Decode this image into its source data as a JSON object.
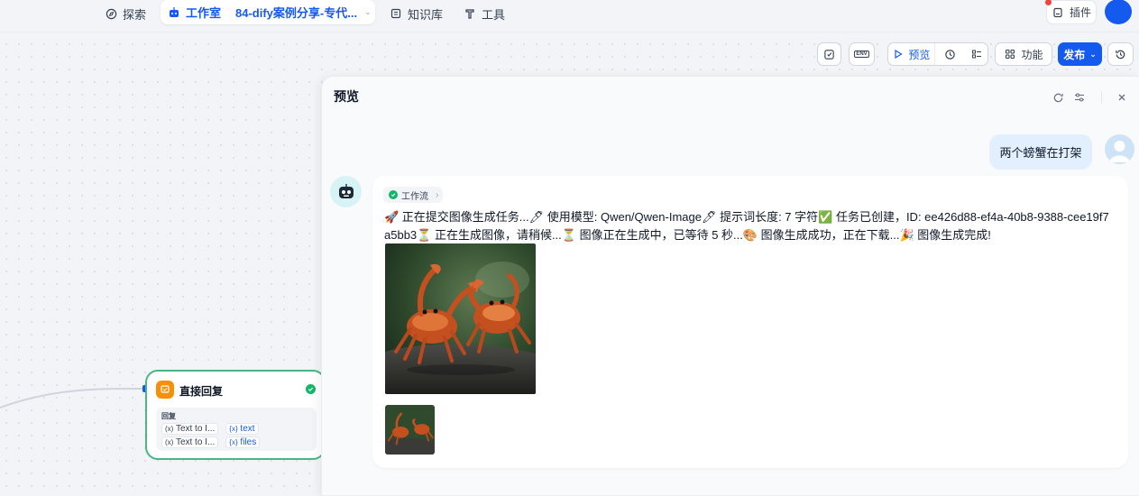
{
  "nav": {
    "explore": "探索",
    "studio": "工作室",
    "app_name": "84-dify案例分享-专代...",
    "knowledge": "知识库",
    "tools": "工具",
    "plugins": "插件"
  },
  "toolbar": {
    "env_label": "ENV",
    "preview": "预览",
    "features": "功能",
    "publish": "发布"
  },
  "node": {
    "title": "直接回复",
    "box_label": "回复",
    "rows": [
      {
        "source": "Text to I...",
        "var": "text"
      },
      {
        "source": "Text to I...",
        "var": "files"
      }
    ]
  },
  "panel": {
    "title": "预览",
    "user_message": "两个螃蟹在打架",
    "workflow_chip": "工作流",
    "answer_text": "🚀 正在提交图像生成任务...🖊 使用模型: Qwen/Qwen-Image🖊 提示词长度: 7 字符✅ 任务已创建，ID: ee426d88-ef4a-40b8-9388-cee19f7a5bb3⏳ 正在生成图像，请稍候...⏳ 图像正在生成中，已等待 5 秒...🎨 图像生成成功，正在下载...🎉 图像生成完成!"
  },
  "colors": {
    "accent": "#155aef",
    "success": "#12b76a",
    "node_border": "#47b881",
    "answer_icon": "#f79009"
  },
  "icons": [
    "explore-icon",
    "robot-icon",
    "knowledge-icon",
    "tools-icon",
    "plugin-icon",
    "checklist-icon",
    "env-icon",
    "play-icon",
    "run-history-icon",
    "variables-icon",
    "features-icon",
    "history-icon",
    "refresh-icon",
    "settings-icon",
    "close-icon"
  ]
}
